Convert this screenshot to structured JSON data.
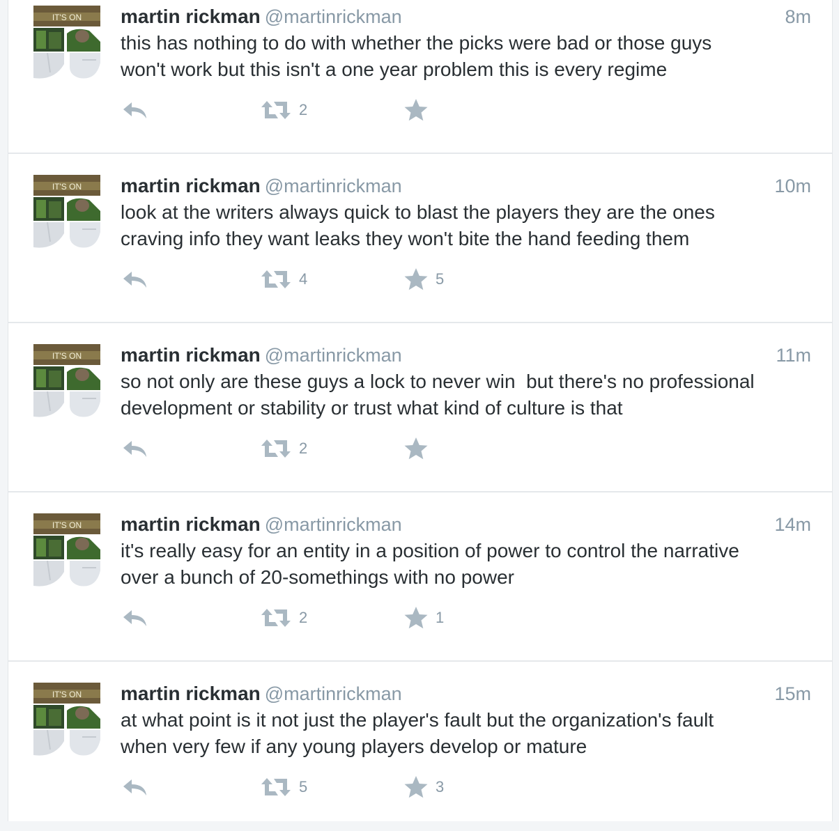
{
  "colors": {
    "icon": "#aab8c2",
    "meta": "#8899a6",
    "text": "#292f33",
    "divider": "#e5e8eb"
  },
  "avatar": {
    "banner_text": "IT'S ON"
  },
  "tweets": [
    {
      "name": "martin rickman",
      "handle": "@martinrickman",
      "time": "8m",
      "text": "this has nothing to do with whether the picks were bad or those guys\nwon't work but this isn't a one year problem this is every regime",
      "retweets": "2",
      "favorites": ""
    },
    {
      "name": "martin rickman",
      "handle": "@martinrickman",
      "time": "10m",
      "text": "look at the writers always quick to blast the players they are the ones\ncraving info they want leaks they won't bite the hand feeding them",
      "retweets": "4",
      "favorites": "5"
    },
    {
      "name": "martin rickman",
      "handle": "@martinrickman",
      "time": "11m",
      "text": "so not only are these guys a lock to never win  but there's no professional\ndevelopment or stability or trust what kind of culture is that",
      "retweets": "2",
      "favorites": ""
    },
    {
      "name": "martin rickman",
      "handle": "@martinrickman",
      "time": "14m",
      "text": "it's really easy for an entity in a position of power to control the narrative\nover a bunch of 20-somethings with no power",
      "retweets": "2",
      "favorites": "1"
    },
    {
      "name": "martin rickman",
      "handle": "@martinrickman",
      "time": "15m",
      "text": "at what point is it not just the player's fault but the organization's fault\nwhen very few if any young players develop or mature",
      "retweets": "5",
      "favorites": "3"
    }
  ]
}
